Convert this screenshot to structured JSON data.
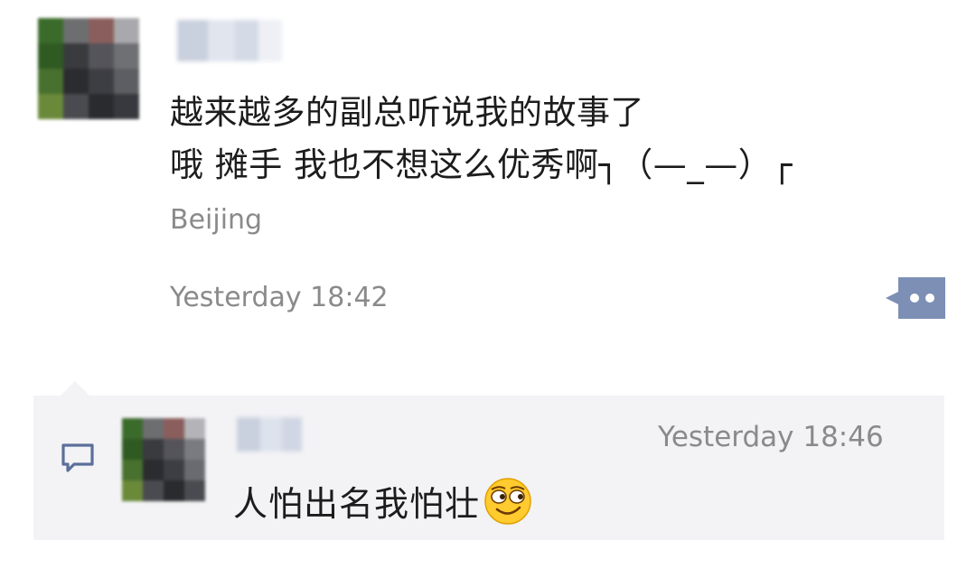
{
  "post": {
    "text": "越来越多的副总听说我的故事了\n哦 摊手 我也不想这么优秀啊┐（—_—）┌",
    "location": "Beijing",
    "time": "Yesterday 18:42"
  },
  "reply": {
    "time": "Yesterday 18:46",
    "text": "人怕出名我怕壮",
    "emoji_icon": "smirk-emoji"
  },
  "colors": {
    "text": "#1c1c1c",
    "meta": "#8a8a8a",
    "reply_bg": "#f3f3f5",
    "action_blue": "#7d8fb5"
  }
}
